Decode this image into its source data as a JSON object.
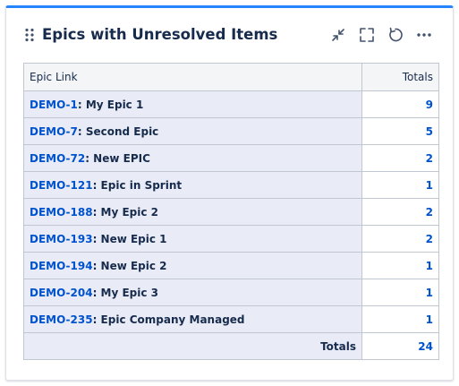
{
  "gadget": {
    "title": "Epics with Unresolved Items",
    "icons": [
      "drag-handle-icon",
      "minimize-icon",
      "fullscreen-icon",
      "refresh-icon",
      "more-options-icon"
    ]
  },
  "table": {
    "headers": {
      "epic": "Epic Link",
      "totals": "Totals"
    },
    "rows": [
      {
        "key": "DEMO-1",
        "name": ": My Epic 1",
        "total": "9"
      },
      {
        "key": "DEMO-7",
        "name": ": Second Epic",
        "total": "5"
      },
      {
        "key": "DEMO-72",
        "name": ": New EPIC",
        "total": "2"
      },
      {
        "key": "DEMO-121",
        "name": ": Epic in Sprint",
        "total": "1"
      },
      {
        "key": "DEMO-188",
        "name": ": My Epic 2",
        "total": "2"
      },
      {
        "key": "DEMO-193",
        "name": ": New Epic 1",
        "total": "2"
      },
      {
        "key": "DEMO-194",
        "name": ": New Epic 2",
        "total": "1"
      },
      {
        "key": "DEMO-204",
        "name": ": My Epic 3",
        "total": "1"
      },
      {
        "key": "DEMO-235",
        "name": ": Epic Company Managed",
        "total": "1"
      }
    ],
    "footer": {
      "label": "Totals",
      "total": "24"
    }
  },
  "colors": {
    "accent": "#2684ff",
    "link": "#0052cc",
    "row_bg": "#e9ecf6",
    "border": "#c1c7d0"
  }
}
